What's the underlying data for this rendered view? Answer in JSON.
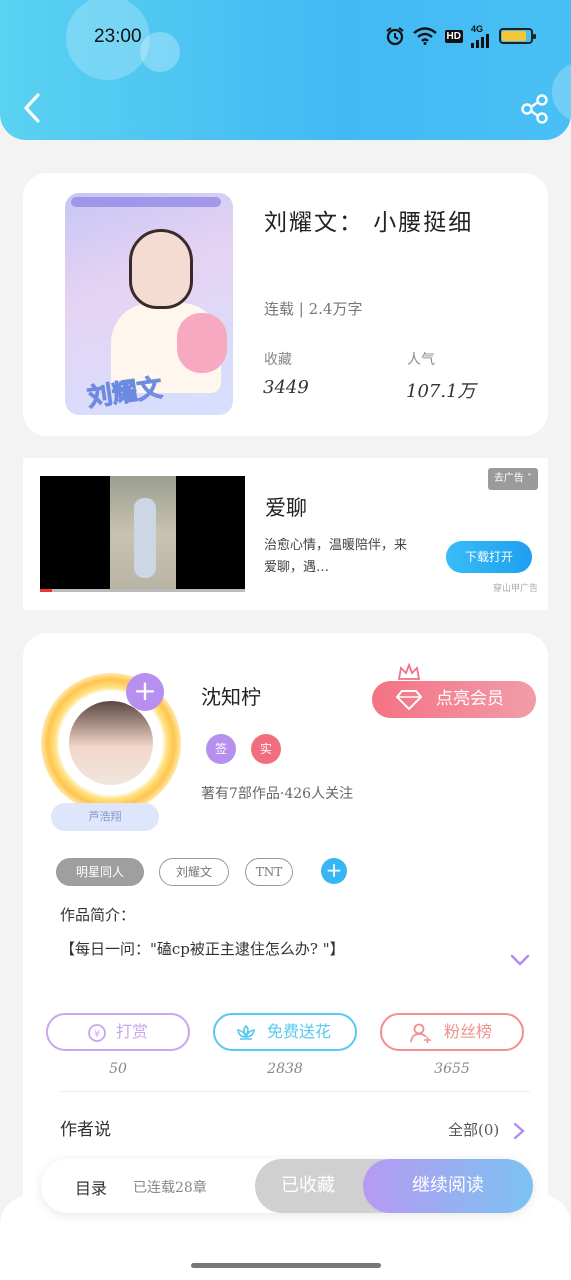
{
  "status_bar": {
    "time": "23:00",
    "hd": "HD",
    "network": "4G",
    "battery_level": 0.85,
    "icons": [
      "alarm-icon",
      "wifi-icon",
      "hd-icon",
      "signal-icon",
      "battery-icon"
    ]
  },
  "header": {
    "back_icon": "chevron-left-icon",
    "share_icon": "share-icon",
    "background_color": "#4cc4f4"
  },
  "book": {
    "title": "刘耀文： 小腰挺细",
    "cover_text": "刘耀文",
    "status": "连载 | 2.4万字",
    "stats": [
      {
        "label": "收藏",
        "value": "3449"
      },
      {
        "label": "人气",
        "value": "107.1万"
      }
    ]
  },
  "ad": {
    "name": "爱聊",
    "description": "治愈心情，温暖陪伴，来爱聊，遇…",
    "close_label": "去广告",
    "download_label": "下载打开",
    "source": "穿山甲广告"
  },
  "author": {
    "name": "沈知柠",
    "voice_badge": "芦浩翔",
    "vip_label": "点亮会员",
    "badges": [
      {
        "text": "签",
        "color": "#b690ee"
      },
      {
        "text": "实",
        "color": "#f26e7e"
      }
    ],
    "meta": "著有7部作品·426人关注"
  },
  "tags": [
    "明星同人",
    "刘耀文",
    "TNT"
  ],
  "intro": {
    "label": "作品简介：",
    "text": "【每日一问：\"磕cp被正主逮住怎么办?  \"】"
  },
  "actions": [
    {
      "label": "打赏",
      "count": "50",
      "color": "#c9a6ef",
      "icon": "coin-icon"
    },
    {
      "label": "免费送花",
      "count": "2838",
      "color": "#58c9ef",
      "icon": "flower-icon"
    },
    {
      "label": "粉丝榜",
      "count": "3655",
      "color": "#f0908f",
      "icon": "fans-icon"
    }
  ],
  "author_say": {
    "label": "作者说",
    "all_link": "全部(0)"
  },
  "bottom_bar": {
    "toc_label": "目录",
    "chapters_label": "已连载28章",
    "collected_label": "已收藏",
    "continue_label": "继续阅读"
  }
}
